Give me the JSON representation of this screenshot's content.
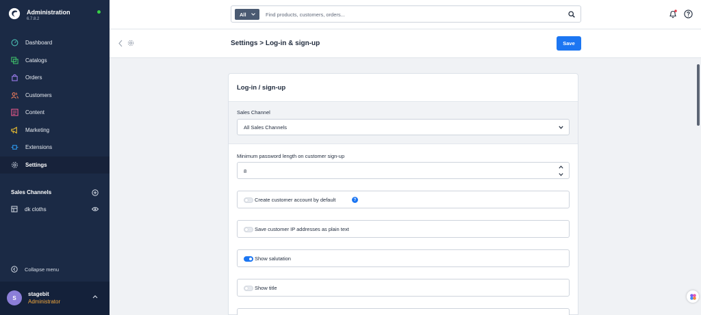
{
  "app": {
    "name": "Administration",
    "version": "6.7.8.2"
  },
  "sidebar": {
    "items": [
      {
        "label": "Dashboard",
        "icon": "dashboard-icon"
      },
      {
        "label": "Catalogs",
        "icon": "catalog-icon"
      },
      {
        "label": "Orders",
        "icon": "orders-icon"
      },
      {
        "label": "Customers",
        "icon": "customers-icon"
      },
      {
        "label": "Content",
        "icon": "content-icon"
      },
      {
        "label": "Marketing",
        "icon": "marketing-icon"
      },
      {
        "label": "Extensions",
        "icon": "extensions-icon"
      },
      {
        "label": "Settings",
        "icon": "settings-icon",
        "active": true
      }
    ],
    "sales_channels_title": "Sales Channels",
    "sales_channels": [
      {
        "label": "dk cloths"
      }
    ],
    "collapse_label": "Collapse menu",
    "user": {
      "initial": "S",
      "name": "stagebit",
      "role": "Administrator"
    }
  },
  "topbar": {
    "search_scope": "All",
    "search_placeholder": "Find products, customers, orders..."
  },
  "smartbar": {
    "title": "Settings > Log-in & sign-up",
    "save_label": "Save"
  },
  "card": {
    "title": "Log-in / sign-up",
    "sales_channel_label": "Sales Channel",
    "sales_channel_value": "All Sales Channels",
    "password_label": "Minimum password length on customer sign-up",
    "password_value": "8",
    "switches": [
      {
        "label": "Create customer account by default",
        "on": false,
        "help": true
      },
      {
        "label": "Save customer IP addresses as plain text",
        "on": false
      },
      {
        "label": "Show salutation",
        "on": true
      },
      {
        "label": "Show title",
        "on": false
      }
    ]
  },
  "colors": {
    "sidebar_bg": "#1b2a45",
    "accent": "#1c76f2",
    "role": "#f3a83b",
    "status_online": "#37d046"
  }
}
